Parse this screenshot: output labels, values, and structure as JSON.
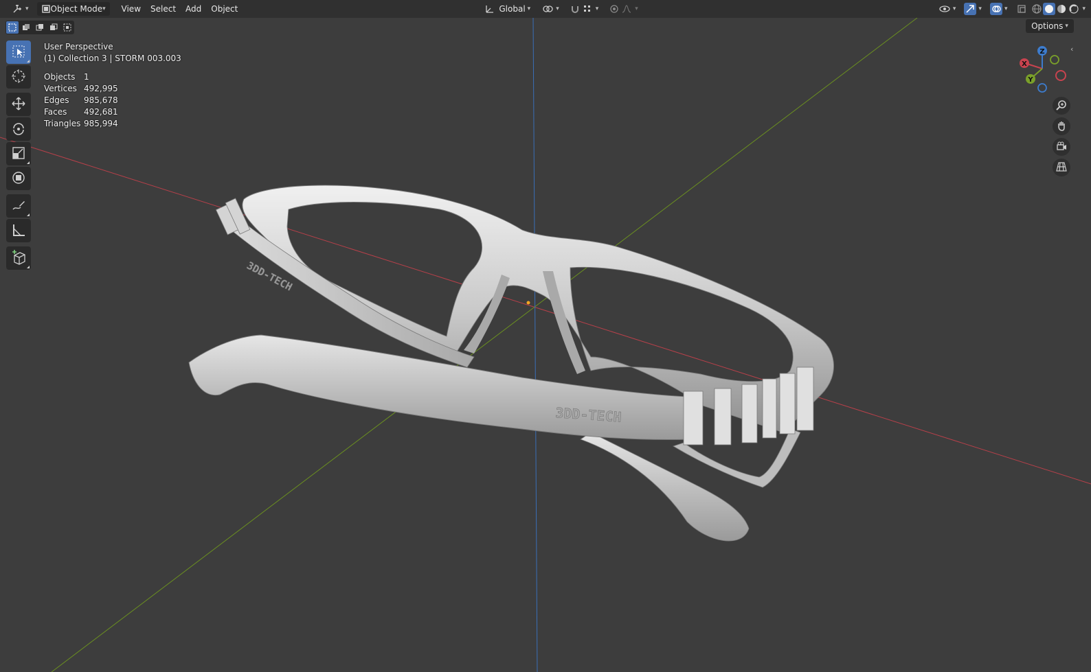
{
  "header": {
    "editor_type_icon": "axes-editor-icon",
    "mode_label": "Object Mode",
    "menus": [
      "View",
      "Select",
      "Add",
      "Object"
    ],
    "transform_orientation": "Global",
    "options_label": "Options"
  },
  "overlay": {
    "view_name": "User Perspective",
    "collection_line": "(1) Collection 3 | STORM 003.003",
    "stats": [
      {
        "label": "Objects",
        "value": "1"
      },
      {
        "label": "Vertices",
        "value": "492,995"
      },
      {
        "label": "Edges",
        "value": "985,678"
      },
      {
        "label": "Faces",
        "value": "492,681"
      },
      {
        "label": "Triangles",
        "value": "985,994"
      }
    ]
  },
  "model": {
    "temple_text_left": "3DD-TECH",
    "temple_text_right": "3DD-TECH"
  },
  "gizmo": {
    "x_label": "X",
    "y_label": "Y",
    "z_label": "Z"
  },
  "colors": {
    "viewport_bg": "#3d3d3d",
    "header_bg": "#303030",
    "accent": "#4772b3",
    "axis_x": "#c8434f",
    "axis_y": "#7aa02a",
    "axis_z": "#3d7ccd",
    "model": "#c9c9c9"
  },
  "toolbar": {
    "tools": [
      "select-box-icon",
      "cursor-icon",
      "move-icon",
      "rotate-icon",
      "scale-icon",
      "transform-icon",
      "annotate-icon",
      "measure-icon",
      "add-cube-icon"
    ]
  }
}
